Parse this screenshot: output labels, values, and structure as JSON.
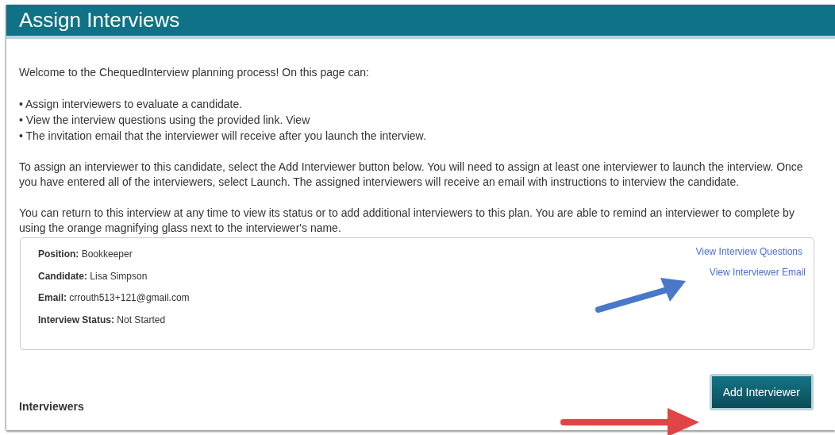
{
  "page": {
    "title": "Assign Interviews"
  },
  "intro": "Welcome to the ChequedInterview planning process! On this page can:",
  "bullets": [
    "• Assign interviewers to evaluate a candidate.",
    "• View the interview questions using the provided link. View",
    "• The invitation email that the interviewer will receive after you launch the interview."
  ],
  "paragraphs": [
    "To assign an interviewer to this candidate, select the Add Interviewer button below. You will need to assign at least one interviewer to launch the interview. Once you have entered all of the interviewers, select Launch. The assigned interviewers will receive an email with instructions to interview the candidate.",
    "You can return to this interview at any time to view its status or to add additional interviewers to this plan. You are able to remind an interviewer to complete by using the orange magnifying glass next to the interviewer's name."
  ],
  "details": [
    {
      "label": "Position:",
      "value": "Bookkeeper"
    },
    {
      "label": "Candidate:",
      "value": "Lisa Simpson"
    },
    {
      "label": "Email:",
      "value": "crrouth513+121@gmail.com"
    },
    {
      "label": "Interview Status:",
      "value": "Not Started"
    }
  ],
  "links": [
    "View Interview Questions",
    "View Interviewer Email"
  ],
  "add_button": "Add Interviewer",
  "section_heading": "Interviewers"
}
